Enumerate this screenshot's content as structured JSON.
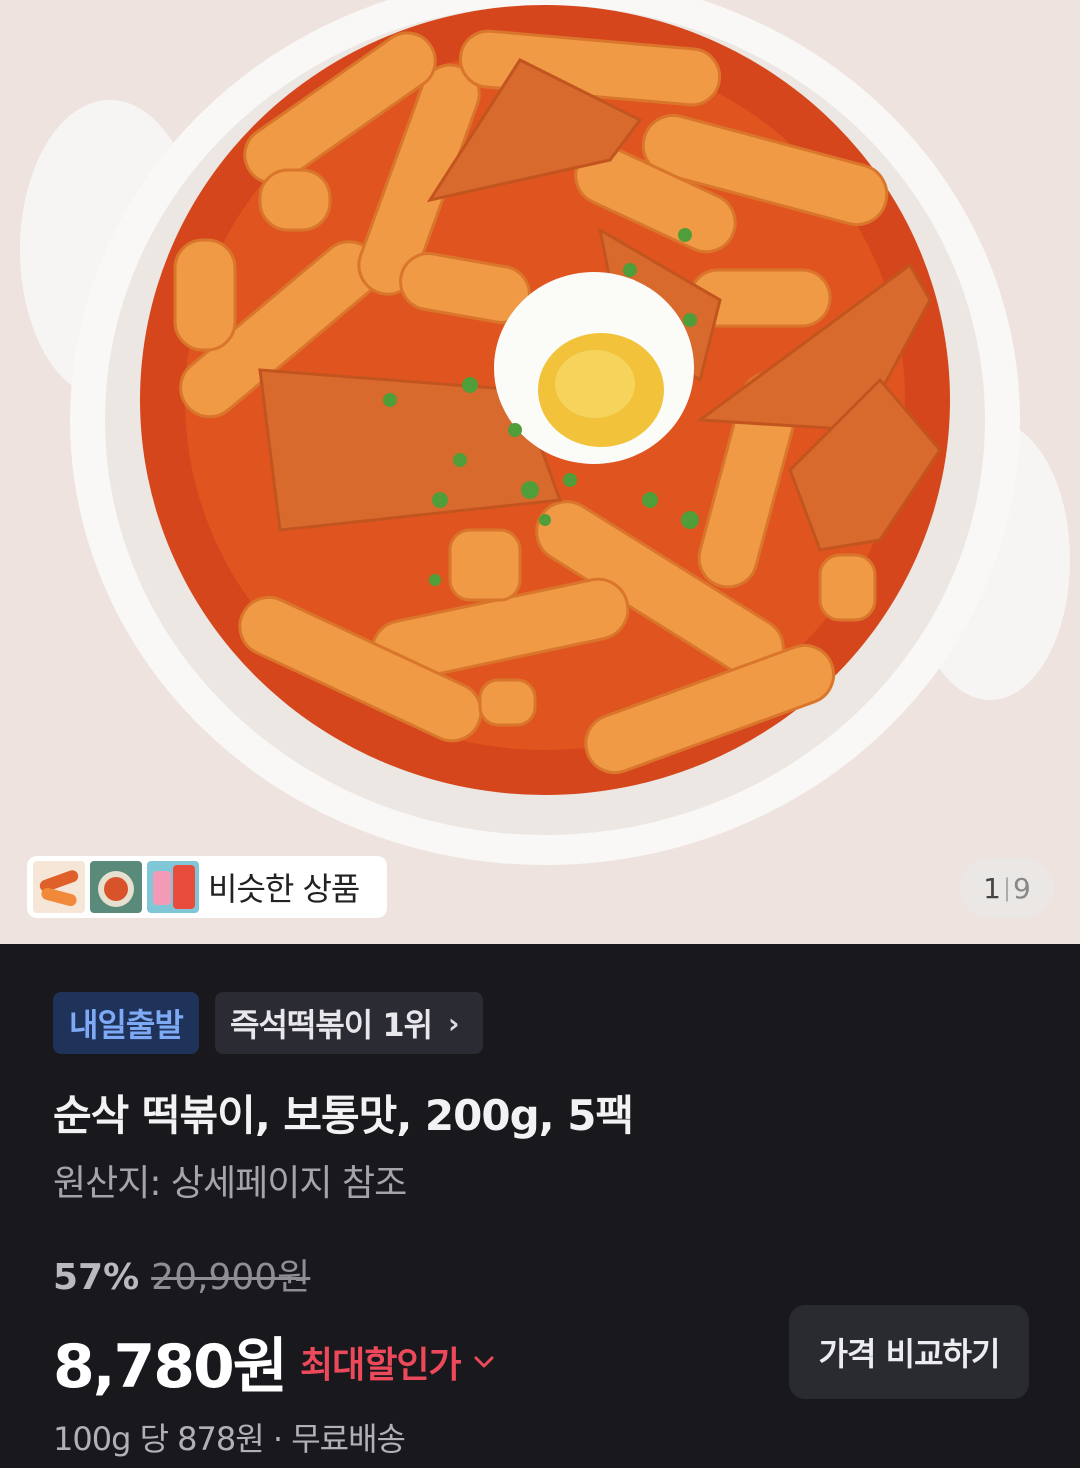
{
  "gallery": {
    "similar_label": "비슷한 상품",
    "current_page": "1",
    "separator": "|",
    "total_pages": "9",
    "image_subject": "tteokbokki-in-white-bowl"
  },
  "badges": {
    "delivery": "내일출발",
    "rank": "즉석떡볶이 1위",
    "rank_chevron": "›"
  },
  "product": {
    "title": "순삭 떡볶이, 보통맛, 200g, 5팩",
    "origin": "원산지: 상세페이지 참조"
  },
  "pricing": {
    "discount_rate": "57%",
    "original_price": "20,900원",
    "price": "8,780원",
    "max_discount_label": "최대할인가",
    "compare_button": "가격 비교하기",
    "unit_price": "100g 당 878원",
    "dot": "·",
    "shipping": "무료배송"
  },
  "colors": {
    "background": "#18181d",
    "delivery_badge_bg": "#1f3259",
    "delivery_badge_text": "#7eaaf5",
    "max_discount": "#ec4a5b"
  }
}
